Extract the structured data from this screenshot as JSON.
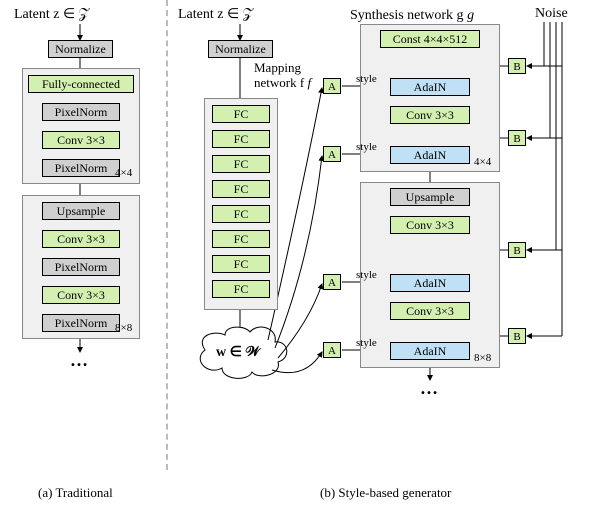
{
  "latent_header": "Latent  z ∈ 𝒵",
  "noise_label": "Noise",
  "mapping_label": "Mapping",
  "network_f": "network f",
  "synthesis_label": "Synthesis network g",
  "normalize": "Normalize",
  "fc_long": "Fully-connected",
  "pixelnorm": "PixelNorm",
  "conv33": "Conv 3×3",
  "upsample": "Upsample",
  "fc": "FC",
  "const": "Const 4×4×512",
  "adain": "AdaIN",
  "A": "A",
  "B": "B",
  "w_latent": "w ∈ 𝒲",
  "style": "style",
  "res_4": "4×4",
  "res_8": "8×8",
  "caption_a": "(a) Traditional",
  "caption_b": "(b) Style-based generator",
  "dots": "…"
}
